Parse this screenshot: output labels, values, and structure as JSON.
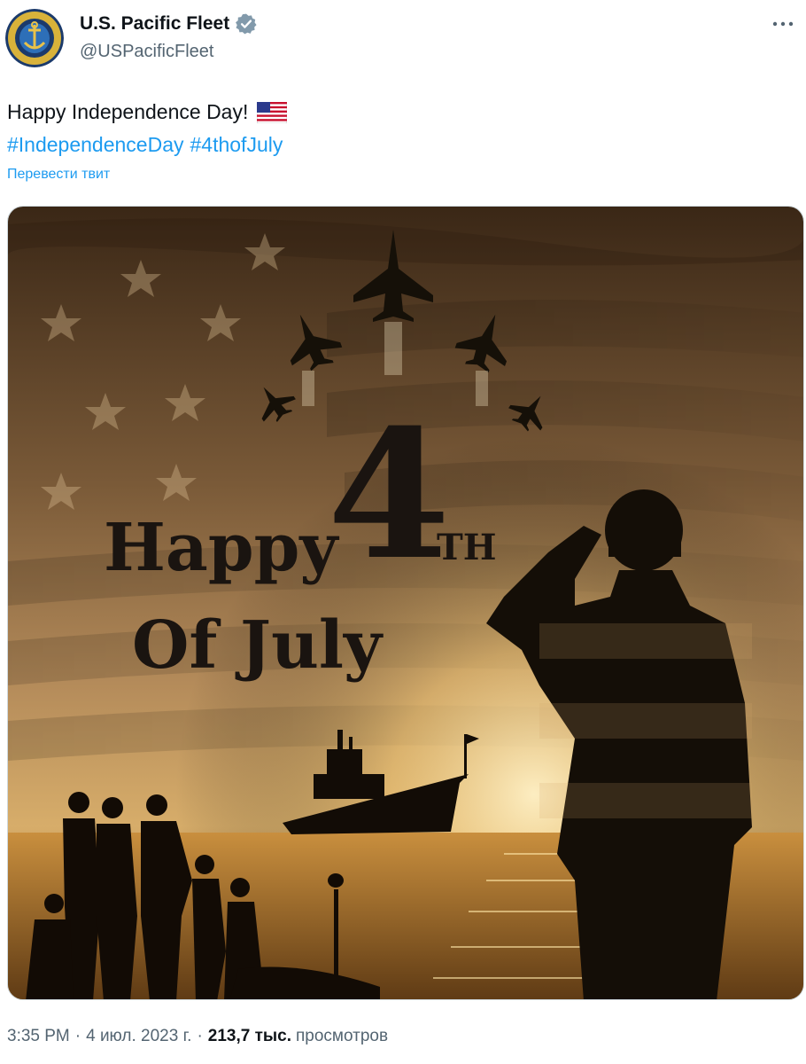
{
  "author": {
    "display_name": "U.S. Pacific Fleet",
    "handle": "@USPacificFleet",
    "verified": true,
    "avatar_icon": "navy-seal-anchor-icon"
  },
  "tweet": {
    "text": "Happy Independence Day!",
    "emoji_icon": "us-flag-icon",
    "hashtags": [
      "#IndependenceDay",
      "#4thofJuly"
    ],
    "translate_label": "Перевести твит"
  },
  "media": {
    "description_icon": "fourth-of-july-poster",
    "poster_text": {
      "happy": "Happy",
      "number": "4",
      "suffix": "TH",
      "line2": "Of July"
    }
  },
  "meta": {
    "time": "3:35 PM",
    "date": "4 июл. 2023 г.",
    "views_count": "213,7 тыс.",
    "views_label": "просмотров",
    "separator": "·"
  },
  "colors": {
    "link": "#1d9bf0",
    "muted": "#536471",
    "text": "#0f1419",
    "verified_badge": "#829aab"
  }
}
